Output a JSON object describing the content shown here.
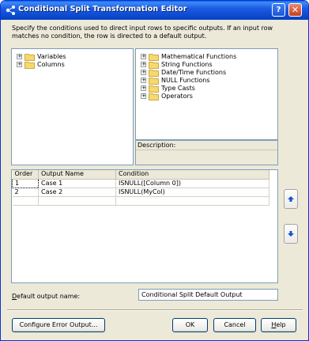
{
  "window": {
    "title": "Conditional Split Transformation Editor"
  },
  "description": "Specify the conditions used to direct input rows to specific outputs. If an input row matches no condition, the row is directed to a default output.",
  "left_tree": [
    {
      "label": "Variables",
      "icon": "folder-icon"
    },
    {
      "label": "Columns",
      "icon": "folder-icon"
    }
  ],
  "right_tree": [
    {
      "label": "Mathematical Functions",
      "icon": "folder-icon"
    },
    {
      "label": "String Functions",
      "icon": "folder-icon"
    },
    {
      "label": "Date/Time Functions",
      "icon": "folder-icon"
    },
    {
      "label": "NULL Functions",
      "icon": "folder-icon"
    },
    {
      "label": "Type Casts",
      "icon": "folder-icon"
    },
    {
      "label": "Operators",
      "icon": "folder-icon"
    }
  ],
  "description_panel": {
    "label": "Description:"
  },
  "grid": {
    "headers": [
      "Order",
      "Output Name",
      "Condition"
    ],
    "rows": [
      {
        "order": "1",
        "name": "Case 1",
        "condition": "ISNULL([Column 0])"
      },
      {
        "order": "2",
        "name": "Case 2",
        "condition": "ISNULL(MyCol)"
      }
    ]
  },
  "default_output": {
    "label_prefix": "D",
    "label_rest": "efault output name:",
    "value": "Conditional Split Default Output"
  },
  "buttons": {
    "configure": "Configure Error Output...",
    "ok": "OK",
    "cancel": "Cancel",
    "help_prefix": "H",
    "help_rest": "elp"
  },
  "caption_buttons": {
    "help": "?",
    "close": "✕"
  },
  "colors": {
    "titlebar": "#0a5fe0",
    "dialog_bg": "#ece9d8",
    "border": "#7f9db9"
  }
}
